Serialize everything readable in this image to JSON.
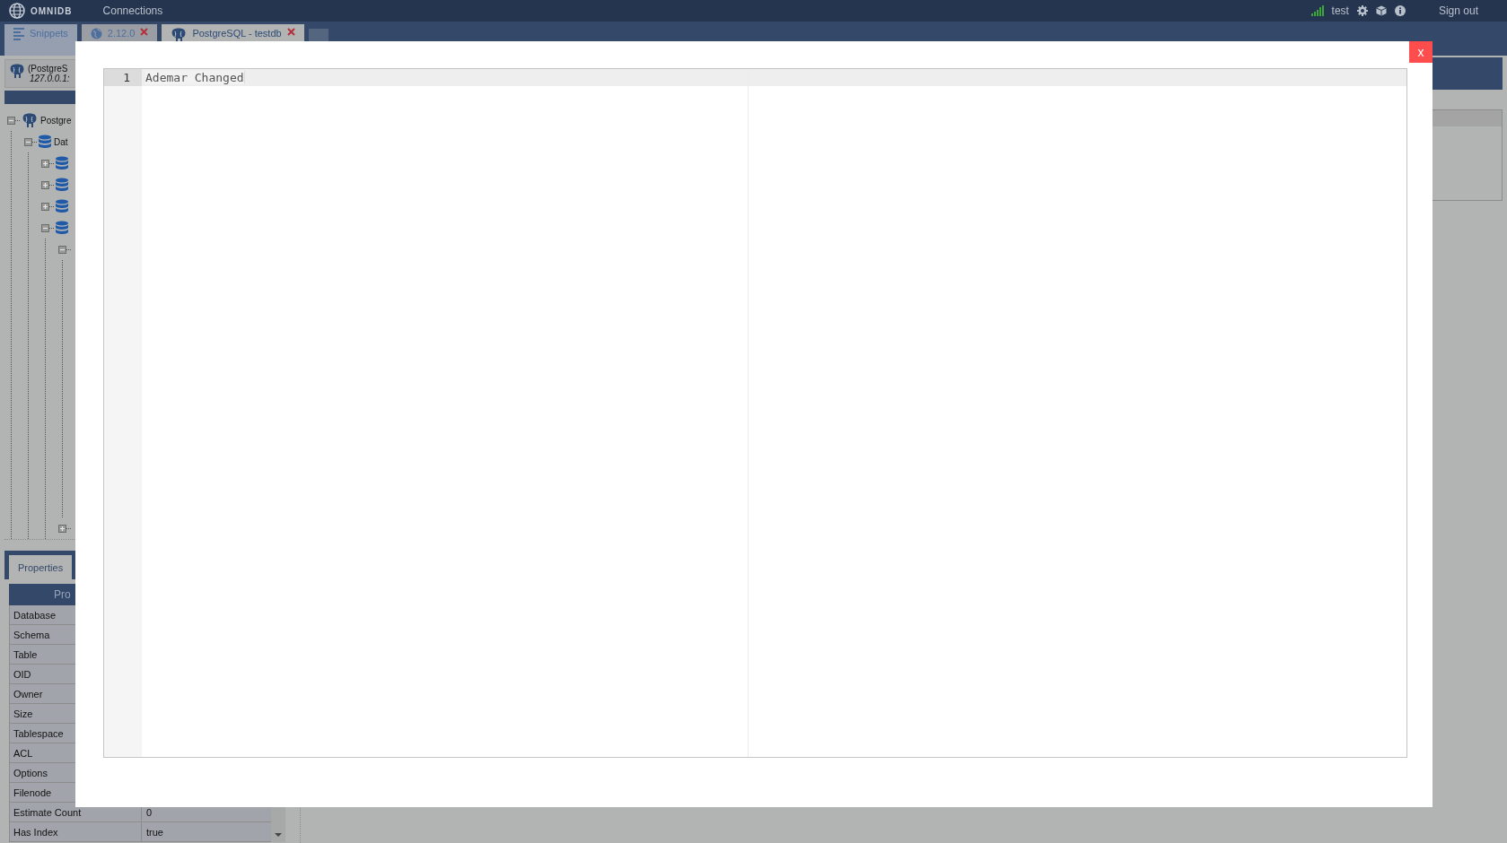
{
  "top_bar": {
    "logo": "OMNIDB",
    "menu": [
      {
        "label": "Connections"
      }
    ],
    "user": "test",
    "sign_out": "Sign out"
  },
  "tabs": [
    {
      "label": "Snippets",
      "kind": "snippets",
      "selected": false,
      "closable": false
    },
    {
      "label": "2.12.0",
      "kind": "web",
      "selected": false,
      "closable": true
    },
    {
      "label": "PostgreSQL - testdb",
      "kind": "postgres",
      "selected": true,
      "closable": true
    },
    {
      "kind": "add",
      "selected": false,
      "closable": false
    }
  ],
  "connection": {
    "name": "(PostgreS",
    "host": "127.0.0.1:"
  },
  "tree": [
    {
      "label": "Postgre",
      "kind": "server",
      "expanded": true,
      "children": [
        {
          "label": "Dat",
          "kind": "database",
          "expanded": true,
          "children": [
            {
              "kind": "database",
              "expanded": false
            },
            {
              "kind": "database",
              "expanded": false
            },
            {
              "kind": "database",
              "expanded": false
            },
            {
              "kind": "database",
              "expanded": true,
              "children": [
                {
                  "expanded": true
                },
                {
                  "expanded": false
                }
              ]
            }
          ]
        }
      ]
    }
  ],
  "properties": {
    "tabs": [
      {
        "label": "Properties",
        "selected": true
      }
    ],
    "header": "Pro",
    "rows": [
      {
        "name": "Database"
      },
      {
        "name": "Schema"
      },
      {
        "name": "Table"
      },
      {
        "name": "OID"
      },
      {
        "name": "Owner"
      },
      {
        "name": "Size"
      },
      {
        "name": "Tablespace"
      },
      {
        "name": "ACL"
      },
      {
        "name": "Options"
      },
      {
        "name": "Filenode"
      },
      {
        "name": "Estimate Count",
        "value": "0"
      },
      {
        "name": "Has Index",
        "value": "true"
      }
    ]
  },
  "modal": {
    "close": "x",
    "editor": {
      "lines": [
        {
          "number": "1",
          "text": "Ademar Changed",
          "active": true
        }
      ]
    }
  }
}
